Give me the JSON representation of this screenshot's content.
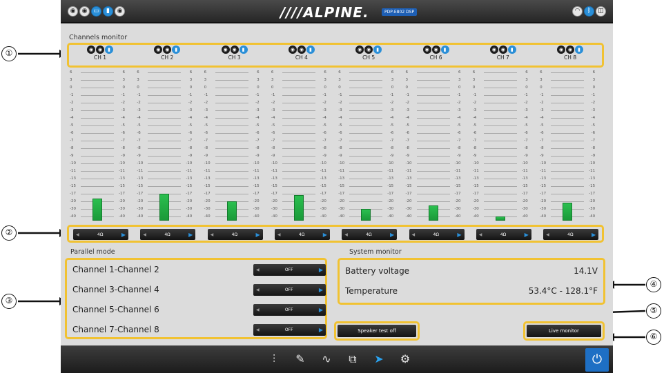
{
  "header": {
    "brand": "////ALPINE.",
    "model": "PDP-E802 DSP",
    "left_icons": [
      "speaker-icon",
      "speaker-icon",
      "battery-icon",
      "temperature-icon",
      "speaker-icon"
    ],
    "right_icons": [
      "wifi-icon",
      "bluetooth-icon",
      "usb-icon"
    ]
  },
  "channels_monitor": {
    "title": "Channels monitor",
    "channels": [
      {
        "name": "CH 1",
        "level": -19,
        "impedance": "4Ω"
      },
      {
        "name": "CH 2",
        "level": -17,
        "impedance": "4Ω"
      },
      {
        "name": "CH 3",
        "level": -20,
        "impedance": "4Ω"
      },
      {
        "name": "CH 4",
        "level": -17.5,
        "impedance": "4Ω"
      },
      {
        "name": "CH 5",
        "level": -30,
        "impedance": "4Ω"
      },
      {
        "name": "CH 6",
        "level": -25,
        "impedance": "4Ω"
      },
      {
        "name": "CH 7",
        "level": -40,
        "impedance": "4Ω"
      },
      {
        "name": "CH 8",
        "level": -22,
        "impedance": "4Ω"
      }
    ],
    "scale_left": [
      "6",
      "3",
      "0",
      "-1",
      "-2",
      "-3",
      "-4",
      "-5",
      "-6",
      "-7",
      "-8",
      "-9",
      "-10",
      "-11",
      "-13",
      "-15",
      "-17",
      "-20",
      "-30",
      "-40"
    ],
    "scale_right": [
      "6",
      "3",
      "0",
      "-1",
      "-2",
      "-3",
      "-4",
      "-5",
      "-6",
      "-7",
      "-8",
      "-9",
      "-10",
      "-11",
      "-13",
      "-15",
      "-17",
      "-20",
      "-30",
      "-40"
    ]
  },
  "parallel_mode": {
    "title": "Parallel mode",
    "rows": [
      {
        "label": "Channel 1-Channel 2",
        "value": "OFF"
      },
      {
        "label": "Channel 3-Channel 4",
        "value": "OFF"
      },
      {
        "label": "Channel 5-Channel 6",
        "value": "OFF"
      },
      {
        "label": "Channel 7-Channel 8",
        "value": "OFF"
      }
    ]
  },
  "system_monitor": {
    "title": "System monitor",
    "battery_label": "Battery voltage",
    "battery_value": "14.1V",
    "temp_label": "Temperature",
    "temp_value": "53.4°C - 128.1°F"
  },
  "buttons": {
    "speaker_test": "Speaker test off",
    "live_monitor": "Live monitor"
  },
  "bottom_bar": {
    "icons": [
      "equalizer-icon",
      "brush-icon",
      "crossover-icon",
      "copy-icon",
      "speaker-output-icon",
      "settings-icon"
    ],
    "active_index": 4
  },
  "callouts": [
    "①",
    "②",
    "③",
    "④",
    "⑤",
    "⑥"
  ],
  "colors": {
    "highlight": "#f1c232",
    "accent": "#2a8fd8",
    "meter_green": "#2bbf4f"
  }
}
